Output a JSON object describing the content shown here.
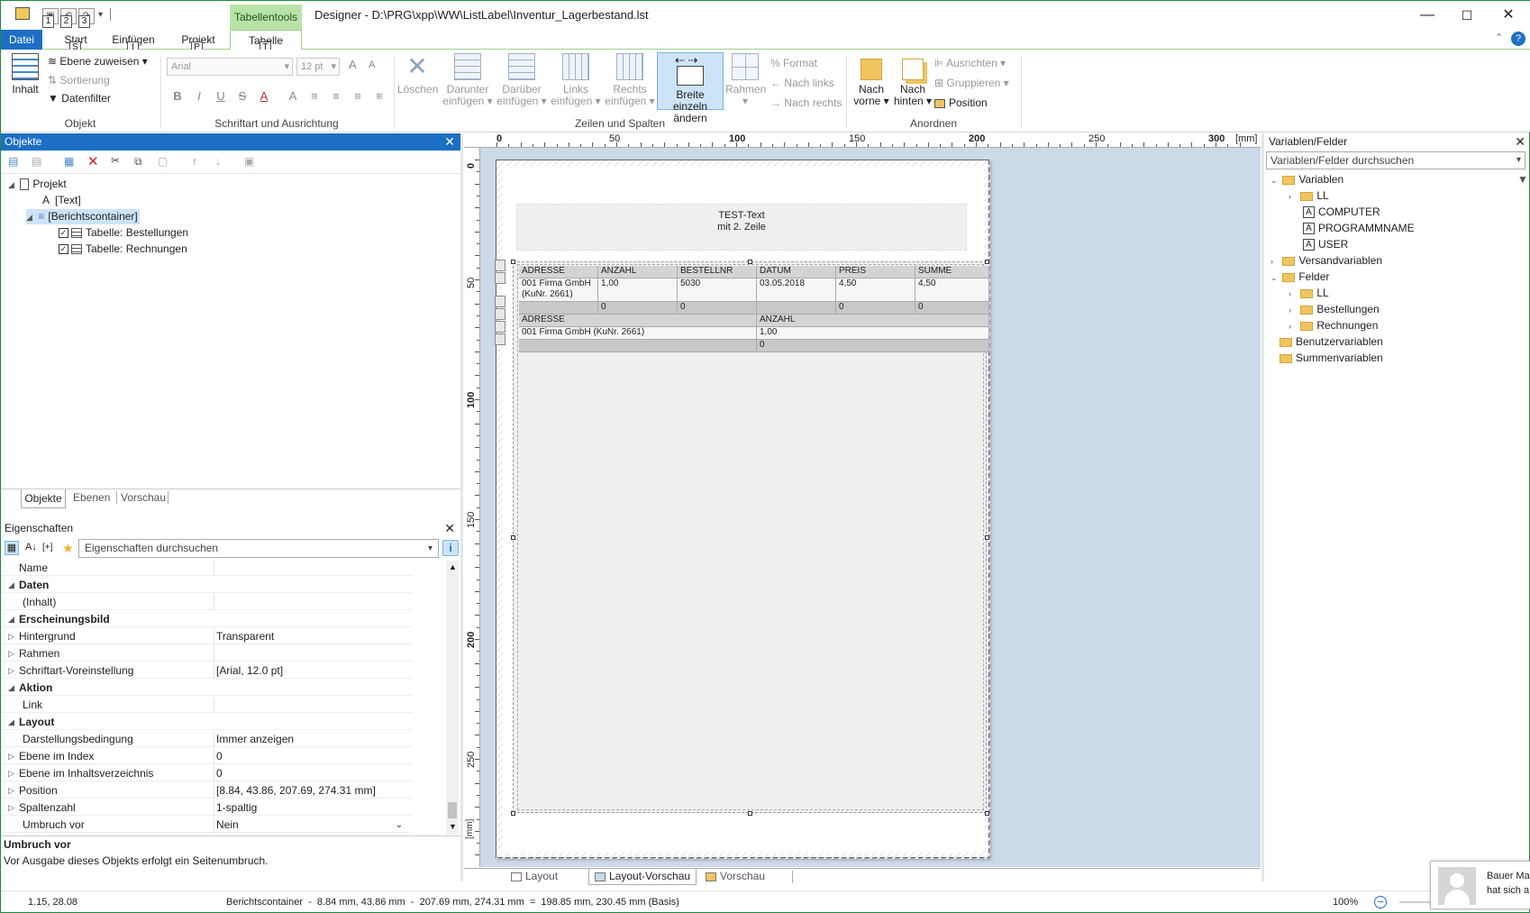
{
  "window": {
    "title": "Designer - D:\\PRG\\xpp\\WW\\ListLabel\\Inventur_Lagerbestand.lst",
    "context_tab": "Tabellentools",
    "controls": {
      "minimize": "—",
      "maximize": "☐",
      "close": "✕"
    },
    "help": "?",
    "accent": "#1e8c3a"
  },
  "quick_access": {
    "keytips": [
      "1",
      "2",
      "3"
    ]
  },
  "tabs": {
    "file": "Datei",
    "items": [
      {
        "label": "Start",
        "keytip": "S"
      },
      {
        "label": "Einfügen",
        "keytip": "I"
      },
      {
        "label": "Projekt",
        "keytip": "P"
      },
      {
        "label": "Tabelle",
        "keytip": "T"
      }
    ]
  },
  "ribbon": {
    "objekt": {
      "label": "Objekt",
      "inhalt": "Inhalt",
      "ebene": "Ebene zuweisen",
      "sortierung": "Sortierung",
      "datenfilter": "Datenfilter"
    },
    "schrift": {
      "label": "Schriftart und Ausrichtung",
      "font": "Arial",
      "size": "12 pt",
      "grow": "A",
      "shrink": "A",
      "buttons": [
        "B",
        "I",
        "U",
        "S",
        "A",
        "A"
      ]
    },
    "zeilen": {
      "label": "Zeilen und Spalten",
      "loeschen": "Löschen",
      "darunter": [
        "Darunter",
        "einfügen"
      ],
      "darueber": [
        "Darüber",
        "einfügen"
      ],
      "links": [
        "Links",
        "einfügen"
      ],
      "rechts": [
        "Rechts",
        "einfügen"
      ],
      "breite": [
        "Breite einzeln",
        "ändern"
      ],
      "rahmen": "Rahmen",
      "format": "Format",
      "nach_links": "Nach links",
      "nach_rechts": "Nach rechts"
    },
    "anordnen": {
      "label": "Anordnen",
      "vorne": [
        "Nach",
        "vorne"
      ],
      "hinten": [
        "Nach",
        "hinten"
      ],
      "ausrichten": "Ausrichten",
      "gruppieren": "Gruppieren",
      "position": "Position"
    }
  },
  "objects_panel": {
    "title": "Objekte",
    "tree": {
      "root": "Projekt",
      "text": "[Text]",
      "container": "[Berichtscontainer]",
      "t1": "Tabelle: Bestellungen",
      "t2": "Tabelle: Rechnungen"
    },
    "tabs": [
      "Objekte",
      "Ebenen",
      "Vorschau"
    ]
  },
  "properties": {
    "title": "Eigenschaften",
    "search_placeholder": "Eigenschaften durchsuchen",
    "rows": [
      {
        "name": "Name",
        "value": "",
        "cat": false,
        "exp": ""
      },
      {
        "name": "Daten",
        "value": "",
        "cat": true,
        "exp": "◢"
      },
      {
        "name": "(Inhalt)",
        "value": "",
        "cat": false,
        "exp": ""
      },
      {
        "name": "Erscheinungsbild",
        "value": "",
        "cat": true,
        "exp": "◢"
      },
      {
        "name": "Hintergrund",
        "value": "Transparent",
        "cat": false,
        "exp": "▷"
      },
      {
        "name": "Rahmen",
        "value": "",
        "cat": false,
        "exp": "▷"
      },
      {
        "name": "Schriftart-Voreinstellung",
        "value": "[Arial, 12.0 pt]",
        "cat": false,
        "exp": "▷"
      },
      {
        "name": "Aktion",
        "value": "",
        "cat": true,
        "exp": "◢"
      },
      {
        "name": "Link",
        "value": "",
        "cat": false,
        "exp": ""
      },
      {
        "name": "Layout",
        "value": "",
        "cat": true,
        "exp": "◢"
      },
      {
        "name": "Darstellungsbedingung",
        "value": "Immer anzeigen",
        "cat": false,
        "exp": ""
      },
      {
        "name": "Ebene im Index",
        "value": "0",
        "cat": false,
        "exp": "▷"
      },
      {
        "name": "Ebene im Inhaltsverzeichnis",
        "value": "0",
        "cat": false,
        "exp": "▷"
      },
      {
        "name": "Position",
        "value": "[8.84, 43.86, 207.69, 274.31 mm]",
        "cat": false,
        "exp": "▷"
      },
      {
        "name": "Spaltenzahl",
        "value": "1-spaltig",
        "cat": false,
        "exp": "▷"
      },
      {
        "name": "Umbruch vor",
        "value": "Nein",
        "cat": false,
        "exp": ""
      }
    ],
    "help_title": "Umbruch vor",
    "help_text": "Vor Ausgabe dieses Objekts erfolgt ein Seitenumbruch."
  },
  "ruler": {
    "unit": "[mm]",
    "h_ticks": [
      "0",
      "50",
      "100",
      "150",
      "200",
      "250",
      "300"
    ],
    "v_ticks": [
      "0",
      "50",
      "100",
      "150",
      "200",
      "250"
    ]
  },
  "page": {
    "text_line1": "TEST-Text",
    "text_line2": "mit 2. Zeile",
    "table1": {
      "headers": [
        "ADRESSE",
        "ANZAHL",
        "BESTELLNR",
        "DATUM",
        "PREIS",
        "SUMME"
      ],
      "row": [
        "001 Firma GmbH",
        "1,00",
        "5030",
        "03.05.2018",
        "4,50",
        "4,50"
      ],
      "row_line2": "(KuNr. 2661)",
      "footer": [
        "",
        "0",
        "0",
        "",
        "0",
        "0"
      ]
    },
    "table2": {
      "headers": [
        "ADRESSE",
        "ANZAHL"
      ],
      "row": [
        "001 Firma GmbH (KuNr. 2661)",
        "1,00"
      ],
      "footer": [
        "",
        "0"
      ]
    }
  },
  "bottom_tabs": [
    "Layout",
    "Layout-Vorschau",
    "Vorschau"
  ],
  "variables_panel": {
    "title": "Variablen/Felder",
    "search_placeholder": "Variablen/Felder durchsuchen",
    "items": {
      "variablen": "Variablen",
      "ll": "LL",
      "computer": "COMPUTER",
      "programmname": "PROGRAMMNAME",
      "user": "USER",
      "versand": "Versandvariablen",
      "felder": "Felder",
      "ll2": "LL",
      "bestellungen": "Bestellungen",
      "rechnungen": "Rechnungen",
      "benutzer": "Benutzervariablen",
      "summen": "Summenvariablen"
    }
  },
  "status": {
    "coords": "1.15, 28.08",
    "info": "Berichtscontainer  -  8.84 mm, 43.86 mm  -  207.69 mm, 274.31 mm  =  198.85 mm, 230.45 mm (Basis)",
    "zoom": "100%"
  },
  "notification": {
    "line1": "Bauer Ma",
    "line2": "hat sich a"
  },
  "colors": {
    "panel_header_blue": "#1c6fc4",
    "canvas_bg": "#cbd9e8",
    "selected_blue": "#cce4f7"
  }
}
